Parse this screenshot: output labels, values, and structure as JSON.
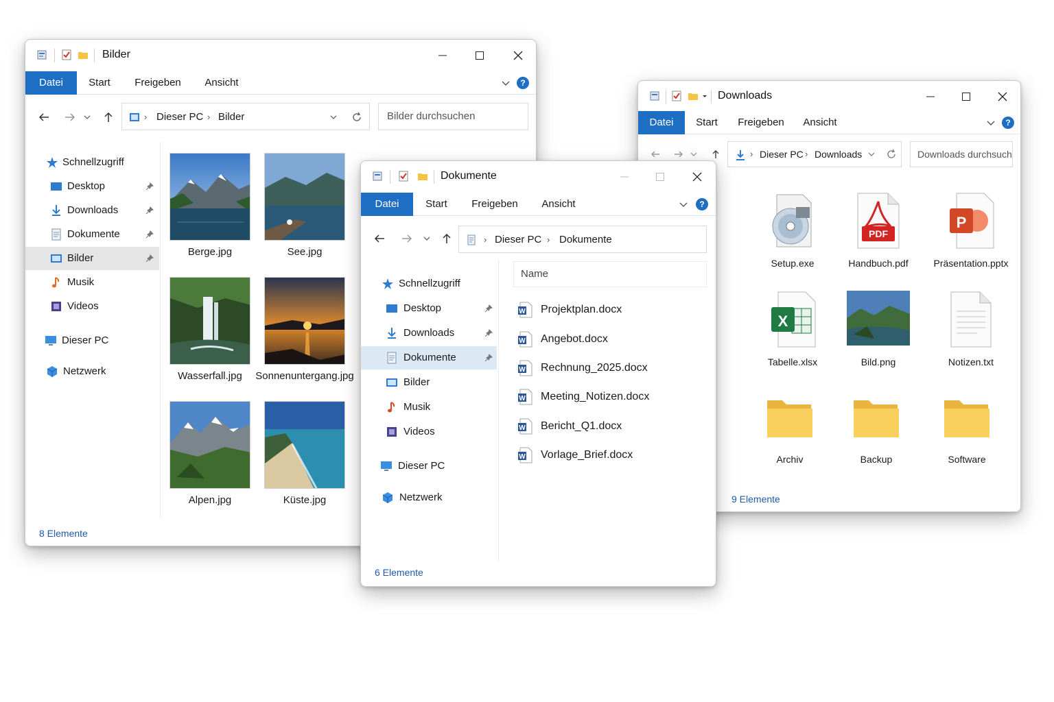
{
  "colors": {
    "accent": "#1e6fc4",
    "status": "#1e5aa8"
  },
  "bilder": {
    "title": "Bilder",
    "ribbon": {
      "tabs": [
        "Datei",
        "Start",
        "Freigeben",
        "Ansicht"
      ],
      "help": "?"
    },
    "address": {
      "crumbs": [
        "Dieser PC",
        "Bilder"
      ]
    },
    "search_placeholder": "Bilder durchsuchen",
    "sidebar": {
      "quick_access": "Schnellzugriff",
      "items": [
        "Desktop",
        "Downloads",
        "Dokumente",
        "Bilder",
        "Musik",
        "Videos"
      ],
      "this_pc": "Dieser PC",
      "network": "Netzwerk"
    },
    "thumbs": [
      {
        "name": "Berge.jpg",
        "icon": "mountain-lake-photo"
      },
      {
        "name": "See.jpg",
        "icon": "lake-pier-photo"
      },
      {
        "name": "Wasserfall.jpg",
        "icon": "waterfall-photo"
      },
      {
        "name": "Sonnenuntergang.jpg",
        "icon": "sunset-photo"
      },
      {
        "name": "Alpen.jpg",
        "icon": "alps-photo"
      },
      {
        "name": "Küste.jpg",
        "icon": "coast-photo"
      }
    ],
    "status": "8 Elemente"
  },
  "dokumente": {
    "title": "Dokumente",
    "ribbon": {
      "tabs": [
        "Datei",
        "Start",
        "Freigeben",
        "Ansicht"
      ],
      "help": "?"
    },
    "address": {
      "crumbs": [
        "Dieser PC",
        "Dokumente"
      ]
    },
    "sidebar": {
      "quick_access": "Schnellzugriff",
      "items": [
        "Desktop",
        "Downloads",
        "Dokumente",
        "Bilder",
        "Musik",
        "Videos"
      ],
      "this_pc": "Dieser PC",
      "network": "Netzwerk"
    },
    "column_header": "Name",
    "files": [
      "Projektplan.docx",
      "Angebot.docx",
      "Rechnung_2025.docx",
      "Meeting_Notizen.docx",
      "Bericht_Q1.docx",
      "Vorlage_Brief.docx"
    ],
    "status": "6 Elemente"
  },
  "downloads": {
    "title": "Downloads",
    "ribbon": {
      "tabs": [
        "Datei",
        "Start",
        "Freigeben",
        "Ansicht"
      ],
      "help": "?"
    },
    "address": {
      "crumbs": [
        "Dieser PC",
        "Downloads"
      ]
    },
    "search_placeholder": "Downloads durchsuchen",
    "items": [
      {
        "name": "Setup.exe",
        "icon": "installer-disc-icon"
      },
      {
        "name": "Handbuch.pdf",
        "icon": "pdf-icon"
      },
      {
        "name": "Präsentation.pptx",
        "icon": "powerpoint-icon"
      },
      {
        "name": "Tabelle.xlsx",
        "icon": "excel-icon"
      },
      {
        "name": "Bild.png",
        "icon": "image-icon"
      },
      {
        "name": "Notizen.txt",
        "icon": "text-file-icon"
      },
      {
        "name": "Archiv",
        "icon": "folder-icon"
      },
      {
        "name": "Backup",
        "icon": "folder-icon"
      },
      {
        "name": "Software",
        "icon": "folder-icon"
      }
    ],
    "status": "9 Elemente"
  }
}
